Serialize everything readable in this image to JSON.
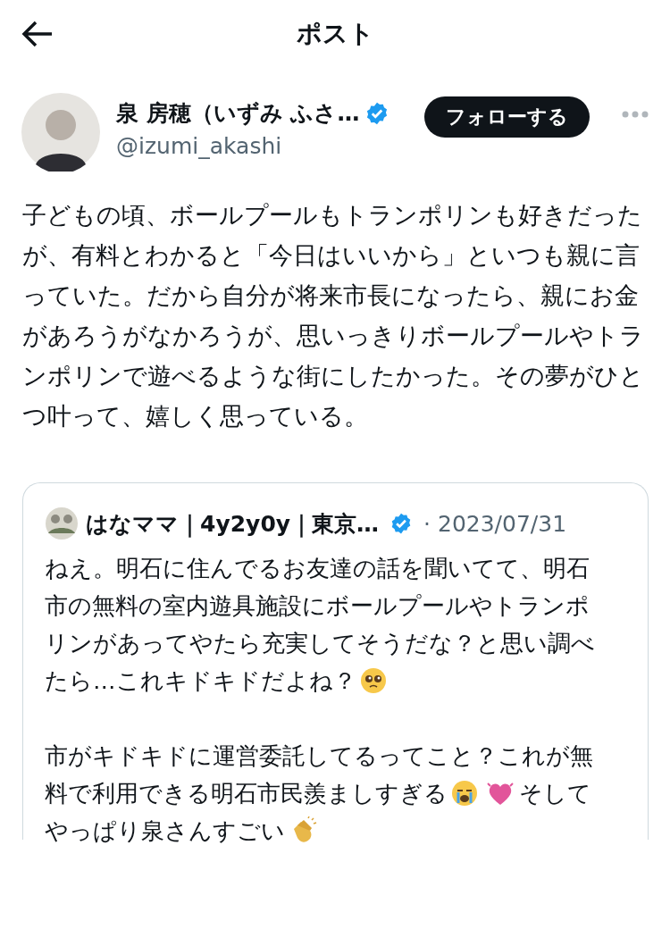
{
  "header": {
    "title": "ポスト"
  },
  "author": {
    "name": "泉 房穂（いずみ ふさ…",
    "verified": true,
    "handle": "@izumi_akashi",
    "follow_label": "フォローする"
  },
  "post": {
    "text": "子どもの頃、ボールプールもトランポリンも好きだったが、有料とわかると「今日はいいから」といつも親に言っていた。だから自分が将来市長になったら、親にお金があろうがなかろうが、思いっきりボールプールやトランポリンで遊べるような街にしたかった。その夢がひとつ叶って、嬉しく思っている。"
  },
  "quote": {
    "name": "はなママ｜4y2y0y｜東京…",
    "verified": true,
    "date": "· 2023/07/31",
    "paragraphs": [
      [
        [
          {
            "kind": "text",
            "text": "ねえ。明石に住んでるお友達の話を聞いてて、明石"
          }
        ],
        [
          {
            "kind": "text",
            "text": "市の無料の室内遊具施設にボールプールやトランポ"
          }
        ],
        [
          {
            "kind": "text",
            "text": "リンがあってやたら充実してそうだな？と思い調べ"
          }
        ],
        [
          {
            "kind": "text",
            "text": "たら…これキドキドだよね？"
          },
          {
            "kind": "pleading"
          }
        ]
      ],
      [
        [
          {
            "kind": "text",
            "text": "市がキドキドに運営委託してるってこと？これが無"
          }
        ],
        [
          {
            "kind": "text",
            "text": "料で利用できる明石市民羨ましすぎる"
          },
          {
            "kind": "crying"
          },
          {
            "kind": "heart"
          },
          {
            "kind": "text",
            "text": "そして"
          }
        ],
        [
          {
            "kind": "text",
            "text": "やっぱり泉さんすごい"
          },
          {
            "kind": "clap"
          }
        ]
      ]
    ]
  }
}
